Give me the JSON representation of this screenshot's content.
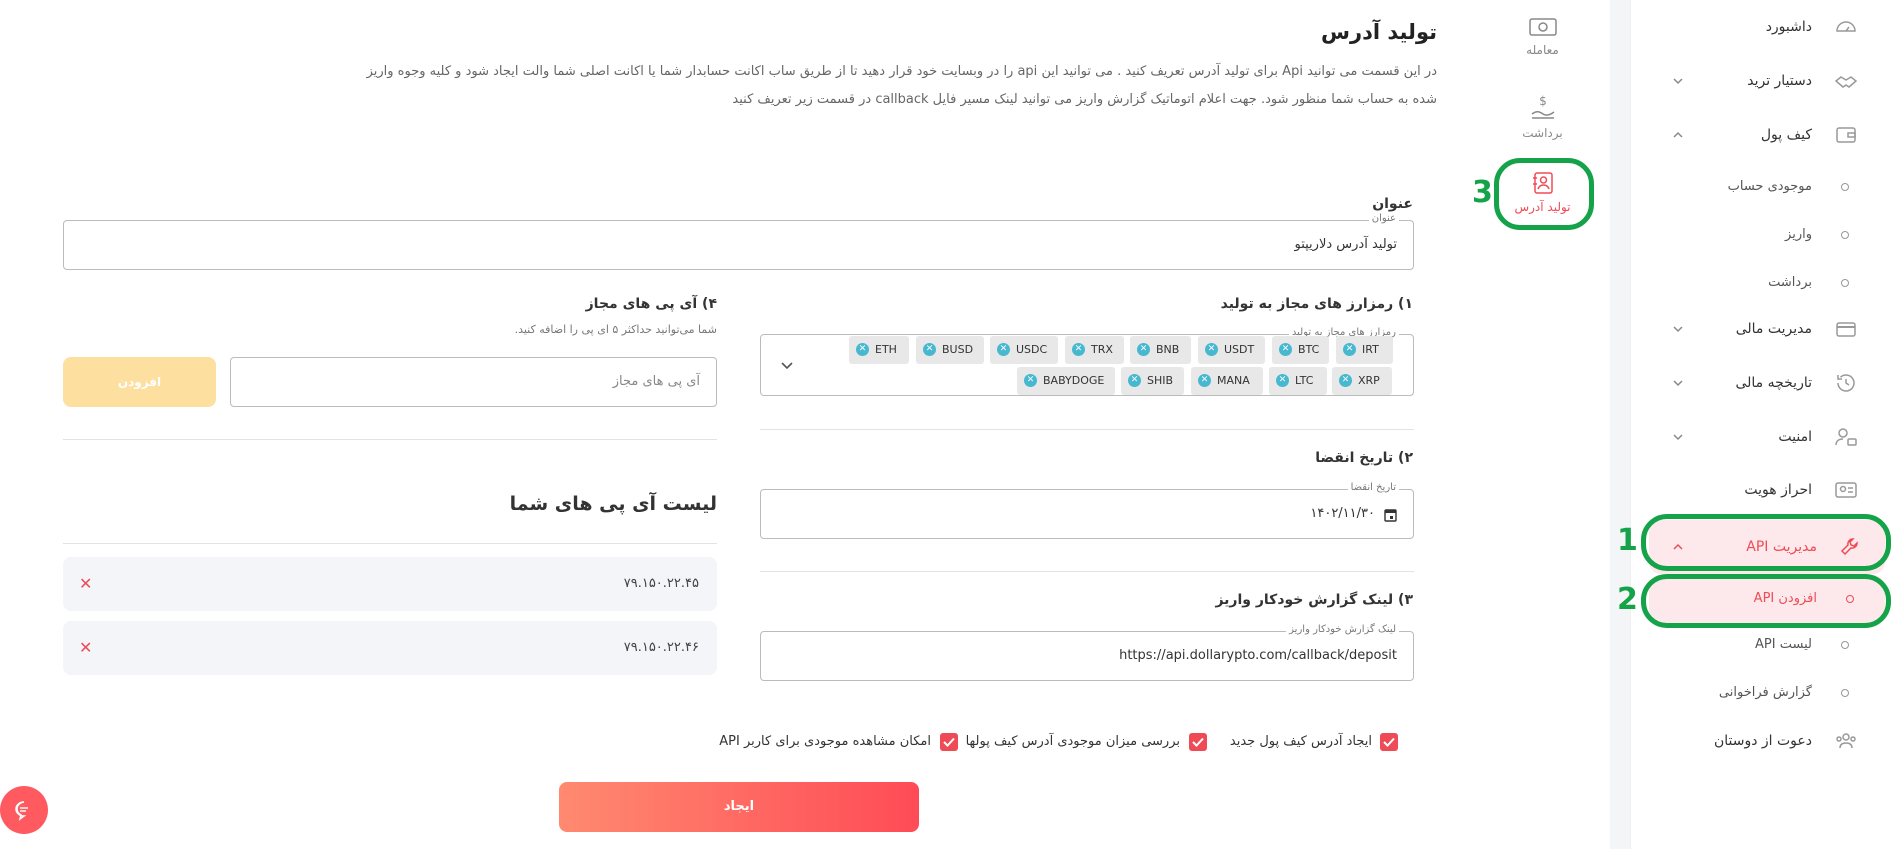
{
  "sidebar": {
    "items": [
      {
        "label": "داشبورد",
        "icon": "dashboard-icon"
      },
      {
        "label": "دستیار ترید",
        "icon": "handshake-icon"
      },
      {
        "label": "کیف پول",
        "icon": "wallet-icon"
      },
      {
        "label": "موجودی حساب"
      },
      {
        "label": "واریز"
      },
      {
        "label": "برداشت"
      },
      {
        "label": "مدیریت مالی",
        "icon": "credit-card-icon"
      },
      {
        "label": "تاریخچه مالی",
        "icon": "history-icon"
      },
      {
        "label": "امنیت",
        "icon": "user-lock-icon"
      },
      {
        "label": "احراز هویت",
        "icon": "id-card-icon"
      },
      {
        "label": "مدیریت API",
        "icon": "wrench-icon"
      },
      {
        "label": "افزودن API"
      },
      {
        "label": "لیست API"
      },
      {
        "label": "گزارش فراخوانی"
      },
      {
        "label": "دعوت از دوستان",
        "icon": "users-icon"
      }
    ]
  },
  "midnav": {
    "items": [
      {
        "label": "معامله",
        "icon": "cash-icon"
      },
      {
        "label": "برداشت",
        "icon": "withdraw-icon"
      },
      {
        "label": "تولید آدرس",
        "icon": "contact-book-icon"
      }
    ]
  },
  "annotations": [
    "1",
    "2",
    "3"
  ],
  "main": {
    "title": "تولید آدرس",
    "desc_line1": "در این قسمت می توانید Api برای تولید آدرس تعریف کنید . می توانید این api را در وبسایت خود قرار دهید تا از طریق ساب اکانت حسابدار شما یا اکانت اصلی شما والت ایجاد شود و کلیه وجوه واریز",
    "desc_line2": "شده به حساب شما منظور شود. جهت اعلام اتوماتیک گزارش واریز می توانید لینک مسیر فایل callback در قسمت زیر تعریف کنید",
    "title_field": {
      "heading": "عنوان",
      "label": "عنوان",
      "value": "تولید آدرس دلاریپتو"
    },
    "currencies": {
      "heading": "۱) رمزارز های مجاز به تولید",
      "label": "رمزارز های مجاز به تولید",
      "row1": [
        "IRT",
        "BTC",
        "USDT",
        "BNB",
        "TRX",
        "USDC",
        "BUSD",
        "ETH"
      ],
      "row2": [
        "XRP",
        "LTC",
        "MANA",
        "SHIB",
        "BABYDOGE"
      ]
    },
    "expiry": {
      "heading": "۲) تاریخ انقضا",
      "label": "تاریخ انقضا",
      "value": "۱۴۰۲/۱۱/۳۰"
    },
    "callback": {
      "heading": "۳) لینک گزارش خودکار واریز",
      "label": "لینک گزارش خودکار واریز",
      "value": "https://api.dollarypto.com/callback/deposit"
    },
    "ips": {
      "heading": "۴) آی پی های مجاز",
      "hint": "شما می‌توانید حداکثر ۵ ای پی را اضافه کنید.",
      "placeholder": "آی پی های مجاز",
      "add_label": "افزودن",
      "list_title": "لیست آی پی های شما",
      "list": [
        "۷۹.۱۵۰.۲۲.۴۵",
        "۷۹.۱۵۰.۲۲.۴۶"
      ]
    },
    "checkboxes": [
      "ایجاد آدرس کیف پول جدید",
      "بررسی میزان موجودی آدرس کیف پولها",
      "امکان مشاهده موجودی برای کاربر API"
    ],
    "submit_label": "ایجاد"
  },
  "colors": {
    "accent": "#ef4b57",
    "annotation": "#15a349",
    "chip_close": "#47b8d0",
    "add_button": "#fddf9f"
  }
}
